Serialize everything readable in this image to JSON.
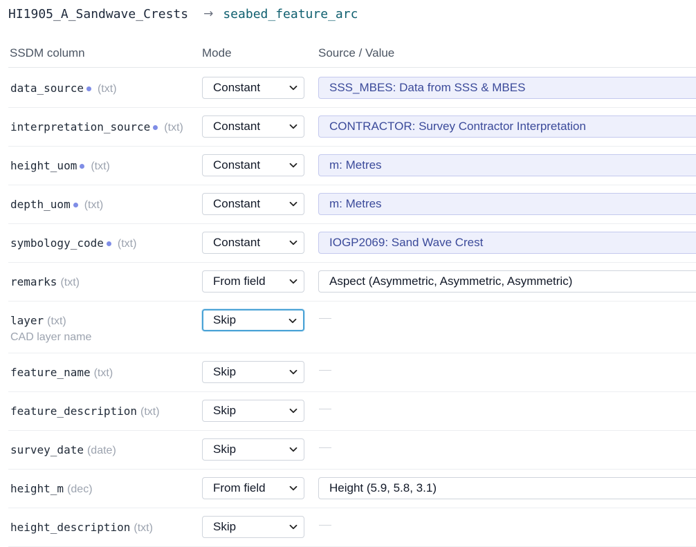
{
  "header": {
    "source_layer": "HI1905_A_Sandwave_Crests",
    "arrow": "→",
    "target_layer": "seabed_feature_arc"
  },
  "columns": {
    "ssdm": "SSDM column",
    "mode": "Mode",
    "source": "Source / Value"
  },
  "rows": [
    {
      "name": "data_source",
      "type": "(txt)",
      "required": true,
      "desc": "",
      "mode": "Constant",
      "value": "SSS_MBES: Data from SSS & MBES",
      "value_kind": "const"
    },
    {
      "name": "interpretation_source",
      "type": "(txt)",
      "required": true,
      "desc": "",
      "mode": "Constant",
      "value": "CONTRACTOR: Survey Contractor Interpretation",
      "value_kind": "const"
    },
    {
      "name": "height_uom",
      "type": "(txt)",
      "required": true,
      "desc": "",
      "mode": "Constant",
      "value": "m: Metres",
      "value_kind": "const"
    },
    {
      "name": "depth_uom",
      "type": "(txt)",
      "required": true,
      "desc": "",
      "mode": "Constant",
      "value": "m: Metres",
      "value_kind": "const"
    },
    {
      "name": "symbology_code",
      "type": "(txt)",
      "required": true,
      "desc": "",
      "mode": "Constant",
      "value": "IOGP2069: Sand Wave Crest",
      "value_kind": "const"
    },
    {
      "name": "remarks",
      "type": "(txt)",
      "required": false,
      "desc": "",
      "mode": "From field",
      "value": "Aspect (Asymmetric, Asymmetric, Asymmetric)",
      "value_kind": "field"
    },
    {
      "name": "layer",
      "type": "(txt)",
      "required": false,
      "desc": "CAD layer name",
      "mode": "Skip",
      "value": "",
      "value_kind": "none",
      "focused": true
    },
    {
      "name": "feature_name",
      "type": "(txt)",
      "required": false,
      "desc": "",
      "mode": "Skip",
      "value": "",
      "value_kind": "none"
    },
    {
      "name": "feature_description",
      "type": "(txt)",
      "required": false,
      "desc": "",
      "mode": "Skip",
      "value": "",
      "value_kind": "none"
    },
    {
      "name": "survey_date",
      "type": "(date)",
      "required": false,
      "desc": "",
      "mode": "Skip",
      "value": "",
      "value_kind": "none"
    },
    {
      "name": "height_m",
      "type": "(dec)",
      "required": false,
      "desc": "",
      "mode": "From field",
      "value": "Height (5.9, 5.8, 3.1)",
      "value_kind": "field"
    },
    {
      "name": "height_description",
      "type": "(txt)",
      "required": false,
      "desc": "",
      "mode": "Skip",
      "value": "",
      "value_kind": "none"
    }
  ],
  "mode_options_visible": [
    "Constant",
    "From field",
    "Skip"
  ],
  "colors": {
    "required_dot": "#7f8de6",
    "constant_bg": "#eef0fc",
    "constant_text": "#3b4a9a",
    "focus_ring": "#4aa3d6",
    "target_layer_text": "#0f5f6f"
  },
  "icons": {
    "required": "required-dot-icon",
    "dropdown": "chevron-down-icon"
  }
}
